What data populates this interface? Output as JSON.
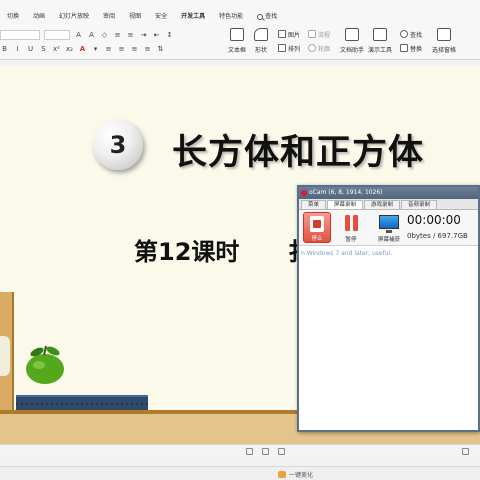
{
  "ribbon": {
    "menu_tabs": [
      "切换",
      "动画",
      "幻灯片放映",
      "审阅",
      "视图",
      "安全",
      "开发工具",
      "特色功能"
    ],
    "search_label": "查找",
    "tools": {
      "textbox": "文本框",
      "shape": "形状",
      "picture": "图片",
      "flowchart": "流程",
      "arrange": "排列",
      "outline": "轮廓",
      "doc_assistant": "文档助手",
      "presenter_tools": "演示工具",
      "find": "查找",
      "replace": "替换",
      "select_pane": "选择窗格"
    }
  },
  "slide": {
    "number": "3",
    "title": "长方体和正方体",
    "subtitle": "第12课时",
    "subtitle_trail": "扌"
  },
  "ocam": {
    "title": "oCam (6, 8, 1914, 1026)",
    "tabs": [
      "菜单",
      "屏幕录制",
      "游戏录制",
      "音频录制"
    ],
    "active_tab": "屏幕录制",
    "stop_label": "停止",
    "pause_label": "暂停",
    "screen_label": "屏幕捕获",
    "timer": "00:00:00",
    "filesize": "0bytes / 697.7GB",
    "message": "n Windows 7 and later, useful."
  },
  "statusbar": {
    "beautify_label": "一键美化"
  }
}
